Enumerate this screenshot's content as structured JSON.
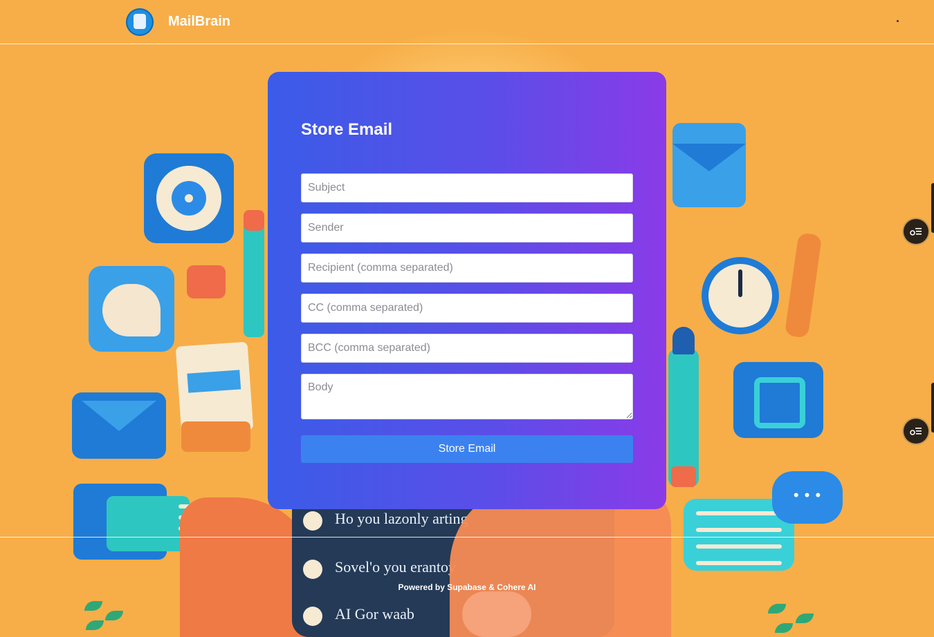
{
  "header": {
    "brand": "MailBrain",
    "logo_icon": "brain-robot-logo-icon"
  },
  "form": {
    "title": "Store Email",
    "subject_placeholder": "Subject",
    "sender_placeholder": "Sender",
    "recipient_placeholder": "Recipient (comma separated)",
    "cc_placeholder": "CC (comma separated)",
    "bcc_placeholder": "BCC (comma separated)",
    "body_placeholder": "Body",
    "submit_label": "Store Email"
  },
  "footer": {
    "prefix": "Powered by",
    "credits": "Supabase & Cohere AI"
  },
  "background_text": {
    "row1": "Ho you lazonly        arting",
    "row2": "Sovel'o you erantoy",
    "row3": "AI Gor waab"
  },
  "colors": {
    "page_bg": "#f7ae48",
    "card_gradient_start": "#3b5ce8",
    "card_gradient_end": "#8a3be8",
    "button": "#3b82f0"
  },
  "side_buttons": {
    "icon": "list-settings-icon"
  }
}
